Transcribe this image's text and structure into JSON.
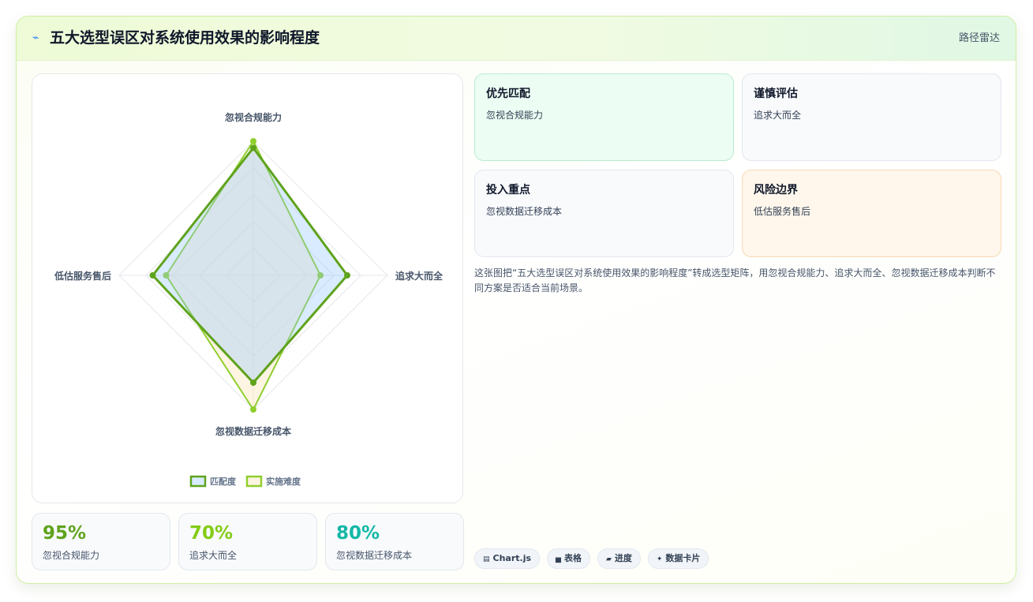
{
  "header": {
    "logo_icon": "trend-line-icon",
    "logo_glyph": "⌁",
    "title": "五大选型误区对系统使用效果的影响程度",
    "tag": "路径雷达"
  },
  "chart_data": {
    "type": "radar",
    "labels": [
      "忽视合规能力",
      "追求大而全",
      "忽视数据迁移成本",
      "低估服务售后"
    ],
    "rlim": [
      0,
      100
    ],
    "grid": true,
    "legend_position": "bottom",
    "series": [
      {
        "name": "匹配度",
        "values": [
          95,
          70,
          80,
          75
        ],
        "color": "#5fa31d",
        "fill": "rgba(147,197,253,0.35)"
      },
      {
        "name": "实施难度",
        "values": [
          100,
          50,
          100,
          65
        ],
        "color": "#8fcf2e",
        "fill": "rgba(253,230,190,0.45)"
      }
    ]
  },
  "stats": [
    {
      "value": "95%",
      "label": "忽视合规能力",
      "color": "#5fa31d"
    },
    {
      "value": "70%",
      "label": "追求大而全",
      "color": "#84cc16"
    },
    {
      "value": "80%",
      "label": "忽视数据迁移成本",
      "color": "#14b8a6"
    }
  ],
  "cards": [
    {
      "title": "优先匹配",
      "body": "忽视合规能力"
    },
    {
      "title": "谨慎评估",
      "body": "追求大而全"
    },
    {
      "title": "投入重点",
      "body": "忽视数据迁移成本"
    },
    {
      "title": "风险边界",
      "body": "低估服务售后"
    }
  ],
  "description": "这张图把“五大选型误区对系统使用效果的影响程度”转成选型矩阵，用忽视合规能力、追求大而全、忽视数据迁移成本判断不同方案是否适合当前场景。",
  "chips": [
    {
      "icon": "chart-icon",
      "glyph": "▤",
      "label": "Chart.js"
    },
    {
      "icon": "table-icon",
      "glyph": "▅",
      "label": "表格"
    },
    {
      "icon": "progress-icon",
      "glyph": "▰",
      "label": "进度"
    },
    {
      "icon": "sparkle-icon",
      "glyph": "✦",
      "label": "数据卡片"
    }
  ]
}
